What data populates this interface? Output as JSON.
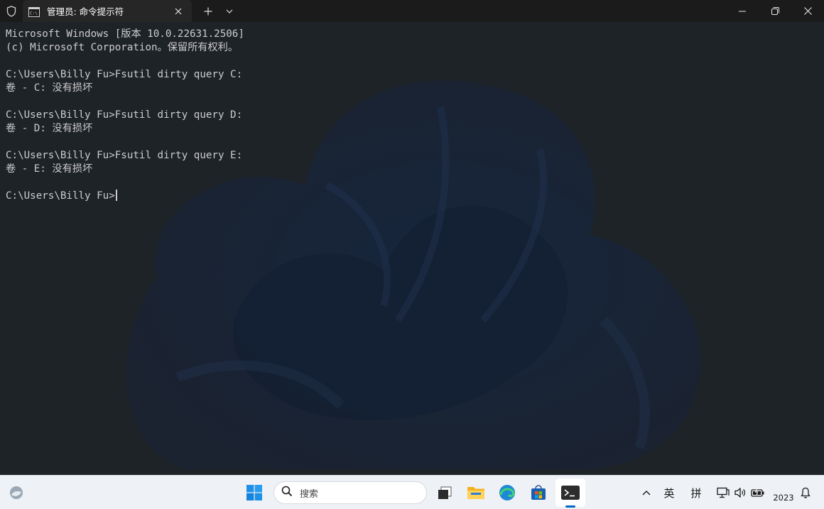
{
  "titlebar": {
    "tab_title": "管理员: 命令提示符"
  },
  "terminal": {
    "lines": [
      "Microsoft Windows [版本 10.0.22631.2506]",
      "(c) Microsoft Corporation。保留所有权利。",
      "",
      "C:\\Users\\Billy Fu>Fsutil dirty query C:",
      "卷 - C: 没有损坏",
      "",
      "C:\\Users\\Billy Fu>Fsutil dirty query D:",
      "卷 - D: 没有损坏",
      "",
      "C:\\Users\\Billy Fu>Fsutil dirty query E:",
      "卷 - E: 没有损坏",
      ""
    ],
    "prompt": "C:\\Users\\Billy Fu>"
  },
  "taskbar": {
    "search_label": "搜索",
    "ime_lang": "英",
    "ime_mode": "拼",
    "clock": "2023"
  },
  "colors": {
    "terminal_text": "#cccccc",
    "terminal_bg": "#1e2328",
    "titlebar_bg": "#1b1b1b",
    "taskbar_bg": "#eef1f5",
    "accent": "#0067c0"
  }
}
